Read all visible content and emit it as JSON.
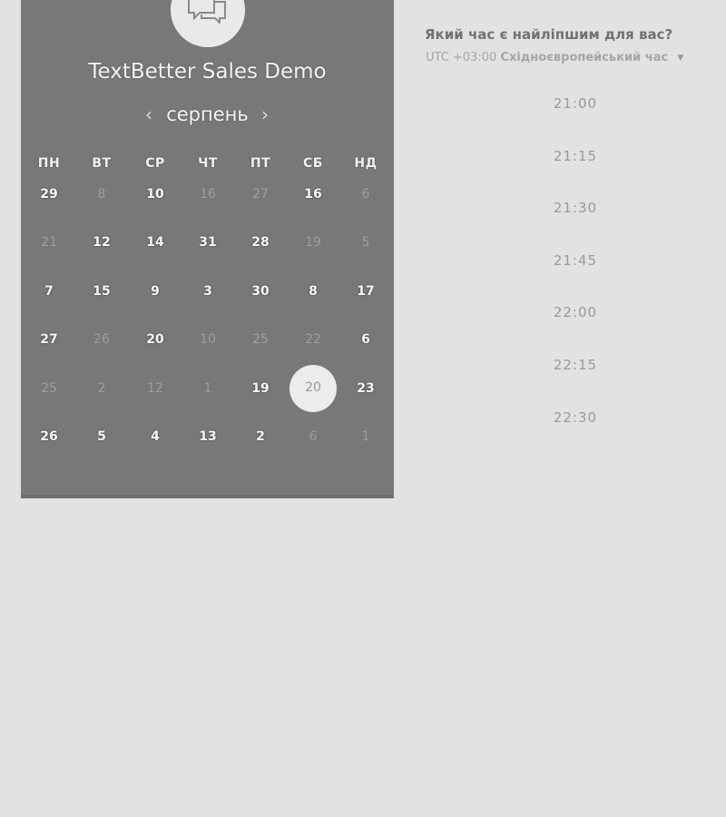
{
  "event": {
    "title": "TextBetter Sales Demo",
    "logo_icon": "chat-bubbles-icon"
  },
  "calendar": {
    "month_label": "серпень",
    "prev_icon": "chevron-left-icon",
    "next_icon": "chevron-right-icon",
    "weekdays": [
      "ПН",
      "ВТ",
      "СР",
      "ЧТ",
      "ПТ",
      "СБ",
      "НД"
    ],
    "weeks": [
      [
        {
          "label": "29",
          "active": true
        },
        {
          "label": "8",
          "active": false
        },
        {
          "label": "10",
          "active": true
        },
        {
          "label": "16",
          "active": false
        },
        {
          "label": "27",
          "active": false
        },
        {
          "label": "16",
          "active": true
        },
        {
          "label": "6",
          "active": false
        }
      ],
      [
        {
          "label": "21",
          "active": false
        },
        {
          "label": "12",
          "active": true
        },
        {
          "label": "14",
          "active": true
        },
        {
          "label": "31",
          "active": true
        },
        {
          "label": "28",
          "active": true
        },
        {
          "label": "19",
          "active": false
        },
        {
          "label": "5",
          "active": false
        }
      ],
      [
        {
          "label": "7",
          "active": true
        },
        {
          "label": "15",
          "active": true
        },
        {
          "label": "9",
          "active": true
        },
        {
          "label": "3",
          "active": true
        },
        {
          "label": "30",
          "active": true
        },
        {
          "label": "8",
          "active": true
        },
        {
          "label": "17",
          "active": true
        }
      ],
      [
        {
          "label": "27",
          "active": true
        },
        {
          "label": "26",
          "active": false
        },
        {
          "label": "20",
          "active": true
        },
        {
          "label": "10",
          "active": false
        },
        {
          "label": "25",
          "active": false
        },
        {
          "label": "22",
          "active": false
        },
        {
          "label": "6",
          "active": true
        }
      ],
      [
        {
          "label": "25",
          "active": false
        },
        {
          "label": "2",
          "active": false
        },
        {
          "label": "12",
          "active": false
        },
        {
          "label": "1",
          "active": false
        },
        {
          "label": "19",
          "active": true
        },
        {
          "label": "20",
          "active": false,
          "selected": true
        },
        {
          "label": "23",
          "active": true
        }
      ],
      [
        {
          "label": "26",
          "active": true
        },
        {
          "label": "5",
          "active": true
        },
        {
          "label": "4",
          "active": true
        },
        {
          "label": "13",
          "active": true
        },
        {
          "label": "2",
          "active": true
        },
        {
          "label": "6",
          "active": false
        },
        {
          "label": "1",
          "active": false
        }
      ]
    ]
  },
  "times": {
    "heading": "Який час є найліпшим для вас?",
    "timezone_offset": "UTC +03:00",
    "timezone_name": "Східноєвропейський час",
    "timezone_caret_icon": "caret-down-icon",
    "slots": [
      "21:00",
      "21:15",
      "21:30",
      "21:45",
      "22:00",
      "22:15",
      "22:30"
    ]
  }
}
